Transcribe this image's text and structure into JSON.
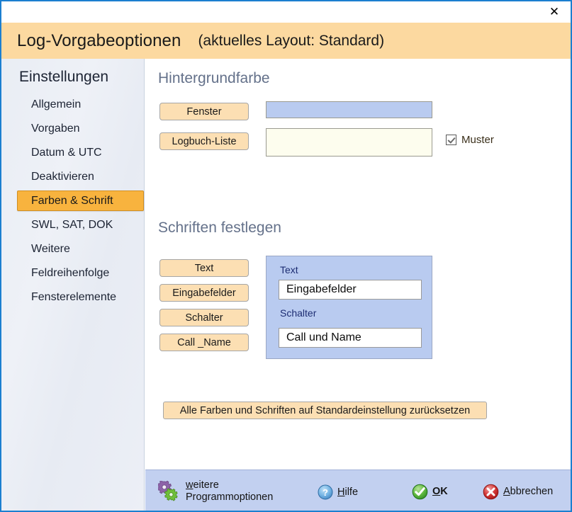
{
  "window": {
    "close_label": "✕",
    "accent_blue": "#1b7fd0",
    "header_bg": "#fcd9a0",
    "button_bg": "#fcdfb3",
    "selected_bg": "#f8b33e",
    "toolbar_bg": "#c2d0f0",
    "panel_blue": "#b9cbf0"
  },
  "header": {
    "title": "Log-Vorgabeoptionen",
    "subtitle": "(aktuelles Layout: Standard)"
  },
  "sidebar": {
    "heading": "Einstellungen",
    "items": [
      {
        "label": "Allgemein",
        "selected": false
      },
      {
        "label": "Vorgaben",
        "selected": false
      },
      {
        "label": "Datum & UTC",
        "selected": false
      },
      {
        "label": "Deaktivieren",
        "selected": false
      },
      {
        "label": "Farben & Schrift",
        "selected": true
      },
      {
        "label": "SWL, SAT, DOK",
        "selected": false
      },
      {
        "label": "Weitere",
        "selected": false
      },
      {
        "label": "Feldreihenfolge",
        "selected": false
      },
      {
        "label": "Fensterelemente",
        "selected": false
      }
    ]
  },
  "background_section": {
    "heading": "Hintergrundfarbe",
    "buttons": [
      {
        "label": "Fenster"
      },
      {
        "label": "Logbuch-Liste"
      }
    ],
    "swatches": [
      {
        "name": "fenster",
        "color": "#b9cbf0"
      },
      {
        "name": "logbuch-liste",
        "color": "#fdfdee"
      }
    ],
    "checkbox": {
      "label": "Muster",
      "checked": true
    }
  },
  "fonts_section": {
    "heading": "Schriften festlegen",
    "buttons": [
      {
        "label": "Text"
      },
      {
        "label": "Eingabefelder"
      },
      {
        "label": "Schalter"
      },
      {
        "label": "Call _Name"
      }
    ],
    "preview": {
      "label_text": "Text",
      "input_eingabefelder": "Eingabefelder",
      "label_schalter": "Schalter",
      "input_call": "Call und Name"
    }
  },
  "reset": {
    "label": "Alle Farben und Schriften auf Standardeinstellung zurücksetzen"
  },
  "toolbar": {
    "options_line1_pre": "w",
    "options_line1_rest": "eitere",
    "options_line2": "Programmoptionen",
    "help_pre": "H",
    "help_rest": "ilfe",
    "ok_pre": "O",
    "ok_rest": "K",
    "cancel_pre": "A",
    "cancel_rest": "bbrechen"
  }
}
